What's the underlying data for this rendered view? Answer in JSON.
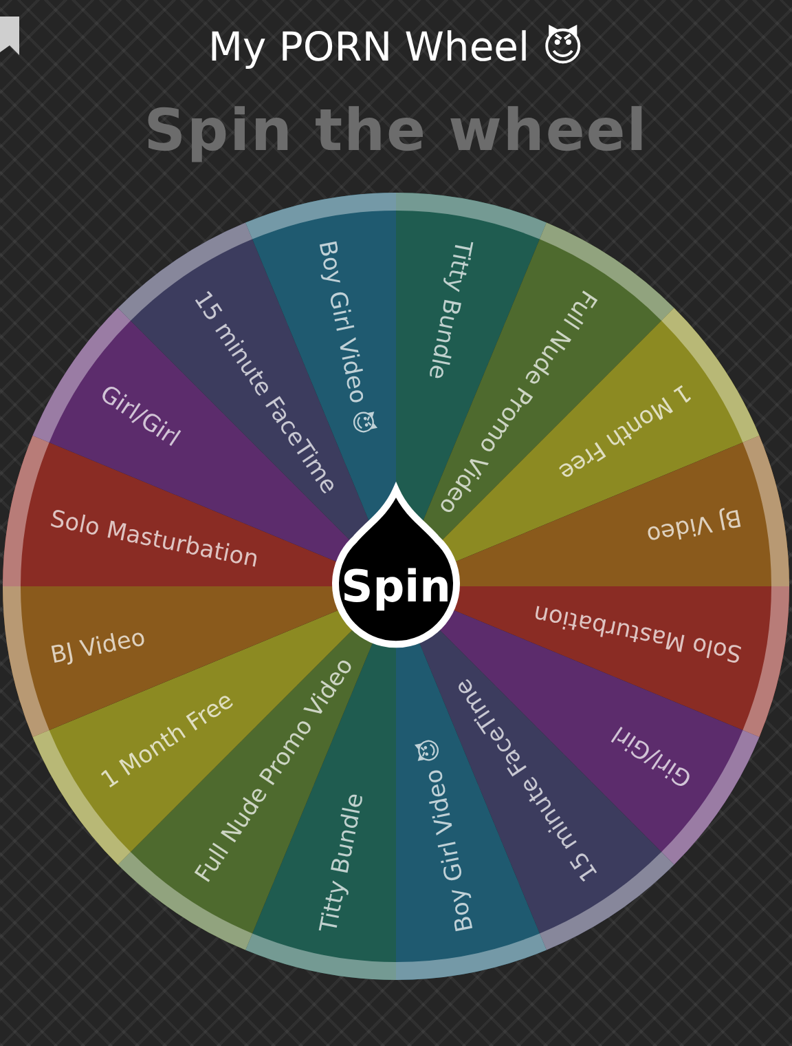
{
  "title": "My PORN Wheel 😈",
  "heading": "Spin the wheel",
  "spin_button": "Spin",
  "segments": [
    {
      "label": "Titty Bundle",
      "color": "#1f5c50"
    },
    {
      "label": "Full Nude Promo Video",
      "color": "#4e6a2e"
    },
    {
      "label": "1 Month Free",
      "color": "#8c8a22"
    },
    {
      "label": "BJ Video",
      "color": "#8a5a1c"
    },
    {
      "label": "Solo Masturbation",
      "color": "#8a2c24"
    },
    {
      "label": "Girl/Girl",
      "color": "#5c2c6c"
    },
    {
      "label": "15 minute FaceTime",
      "color": "#3c3c5e"
    },
    {
      "label": "Boy Girl Video 😈",
      "color": "#1f5a70"
    },
    {
      "label": "Titty Bundle",
      "color": "#1f5c50"
    },
    {
      "label": "Full Nude Promo Video",
      "color": "#4e6a2e"
    },
    {
      "label": "1 Month Free",
      "color": "#8c8a22"
    },
    {
      "label": "BJ Video",
      "color": "#8a5a1c"
    },
    {
      "label": "Solo Masturbation",
      "color": "#8a2c24"
    },
    {
      "label": "Girl/Girl",
      "color": "#5c2c6c"
    },
    {
      "label": "15 minute FaceTime",
      "color": "#3c3c5e"
    },
    {
      "label": "Boy Girl Video 😈",
      "color": "#1f5a70"
    }
  ]
}
